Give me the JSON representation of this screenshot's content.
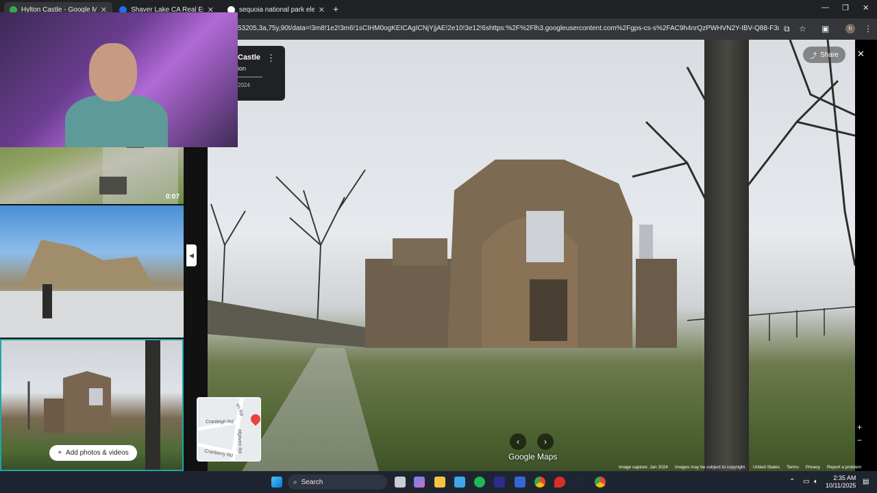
{
  "browser": {
    "tabs": [
      {
        "title": "Hylton Castle - Google Maps",
        "active": true
      },
      {
        "title": "Shaver Lake CA Real Estate - Sh",
        "active": false
      },
      {
        "title": "sequoia national park elevation",
        "active": false
      }
    ],
    "url": "53205,3a,75y,90t/data=!3m8!1e2!3m6!1sCIHM0ogKEICAgICNjYjjAE!2e10!3e12!6shttps:%2F%2Flh3.googleusercontent.com%2Fgps-cs-s%2FAC9h4nrQzPWHVN2Y-IBV-Q88-F3uoarrc3wFtJO...",
    "avatar_letter": "h"
  },
  "place_card": {
    "title": "Castle",
    "subtitle": "ion",
    "date": "2024"
  },
  "left_panel": {
    "video_duration": "0:07",
    "add_photos_label": "Add photos & videos"
  },
  "viewer": {
    "share_label": "Share",
    "brand": "Google Maps",
    "zoom_in": "+",
    "zoom_out": "−"
  },
  "minimap": {
    "labels": [
      "Cranleigh Rd",
      "Cranberry Rd",
      "algavon Rd",
      "on Rd"
    ]
  },
  "footer": {
    "image_capture": "Image capture: Jan 2024",
    "copyright": "Images may be subject to copyright.",
    "country": "United States",
    "terms": "Terms",
    "privacy": "Privacy",
    "report": "Report a problem"
  },
  "taskbar": {
    "search_label": "Search",
    "time": "2:35 AM",
    "date": "10/11/2025"
  }
}
